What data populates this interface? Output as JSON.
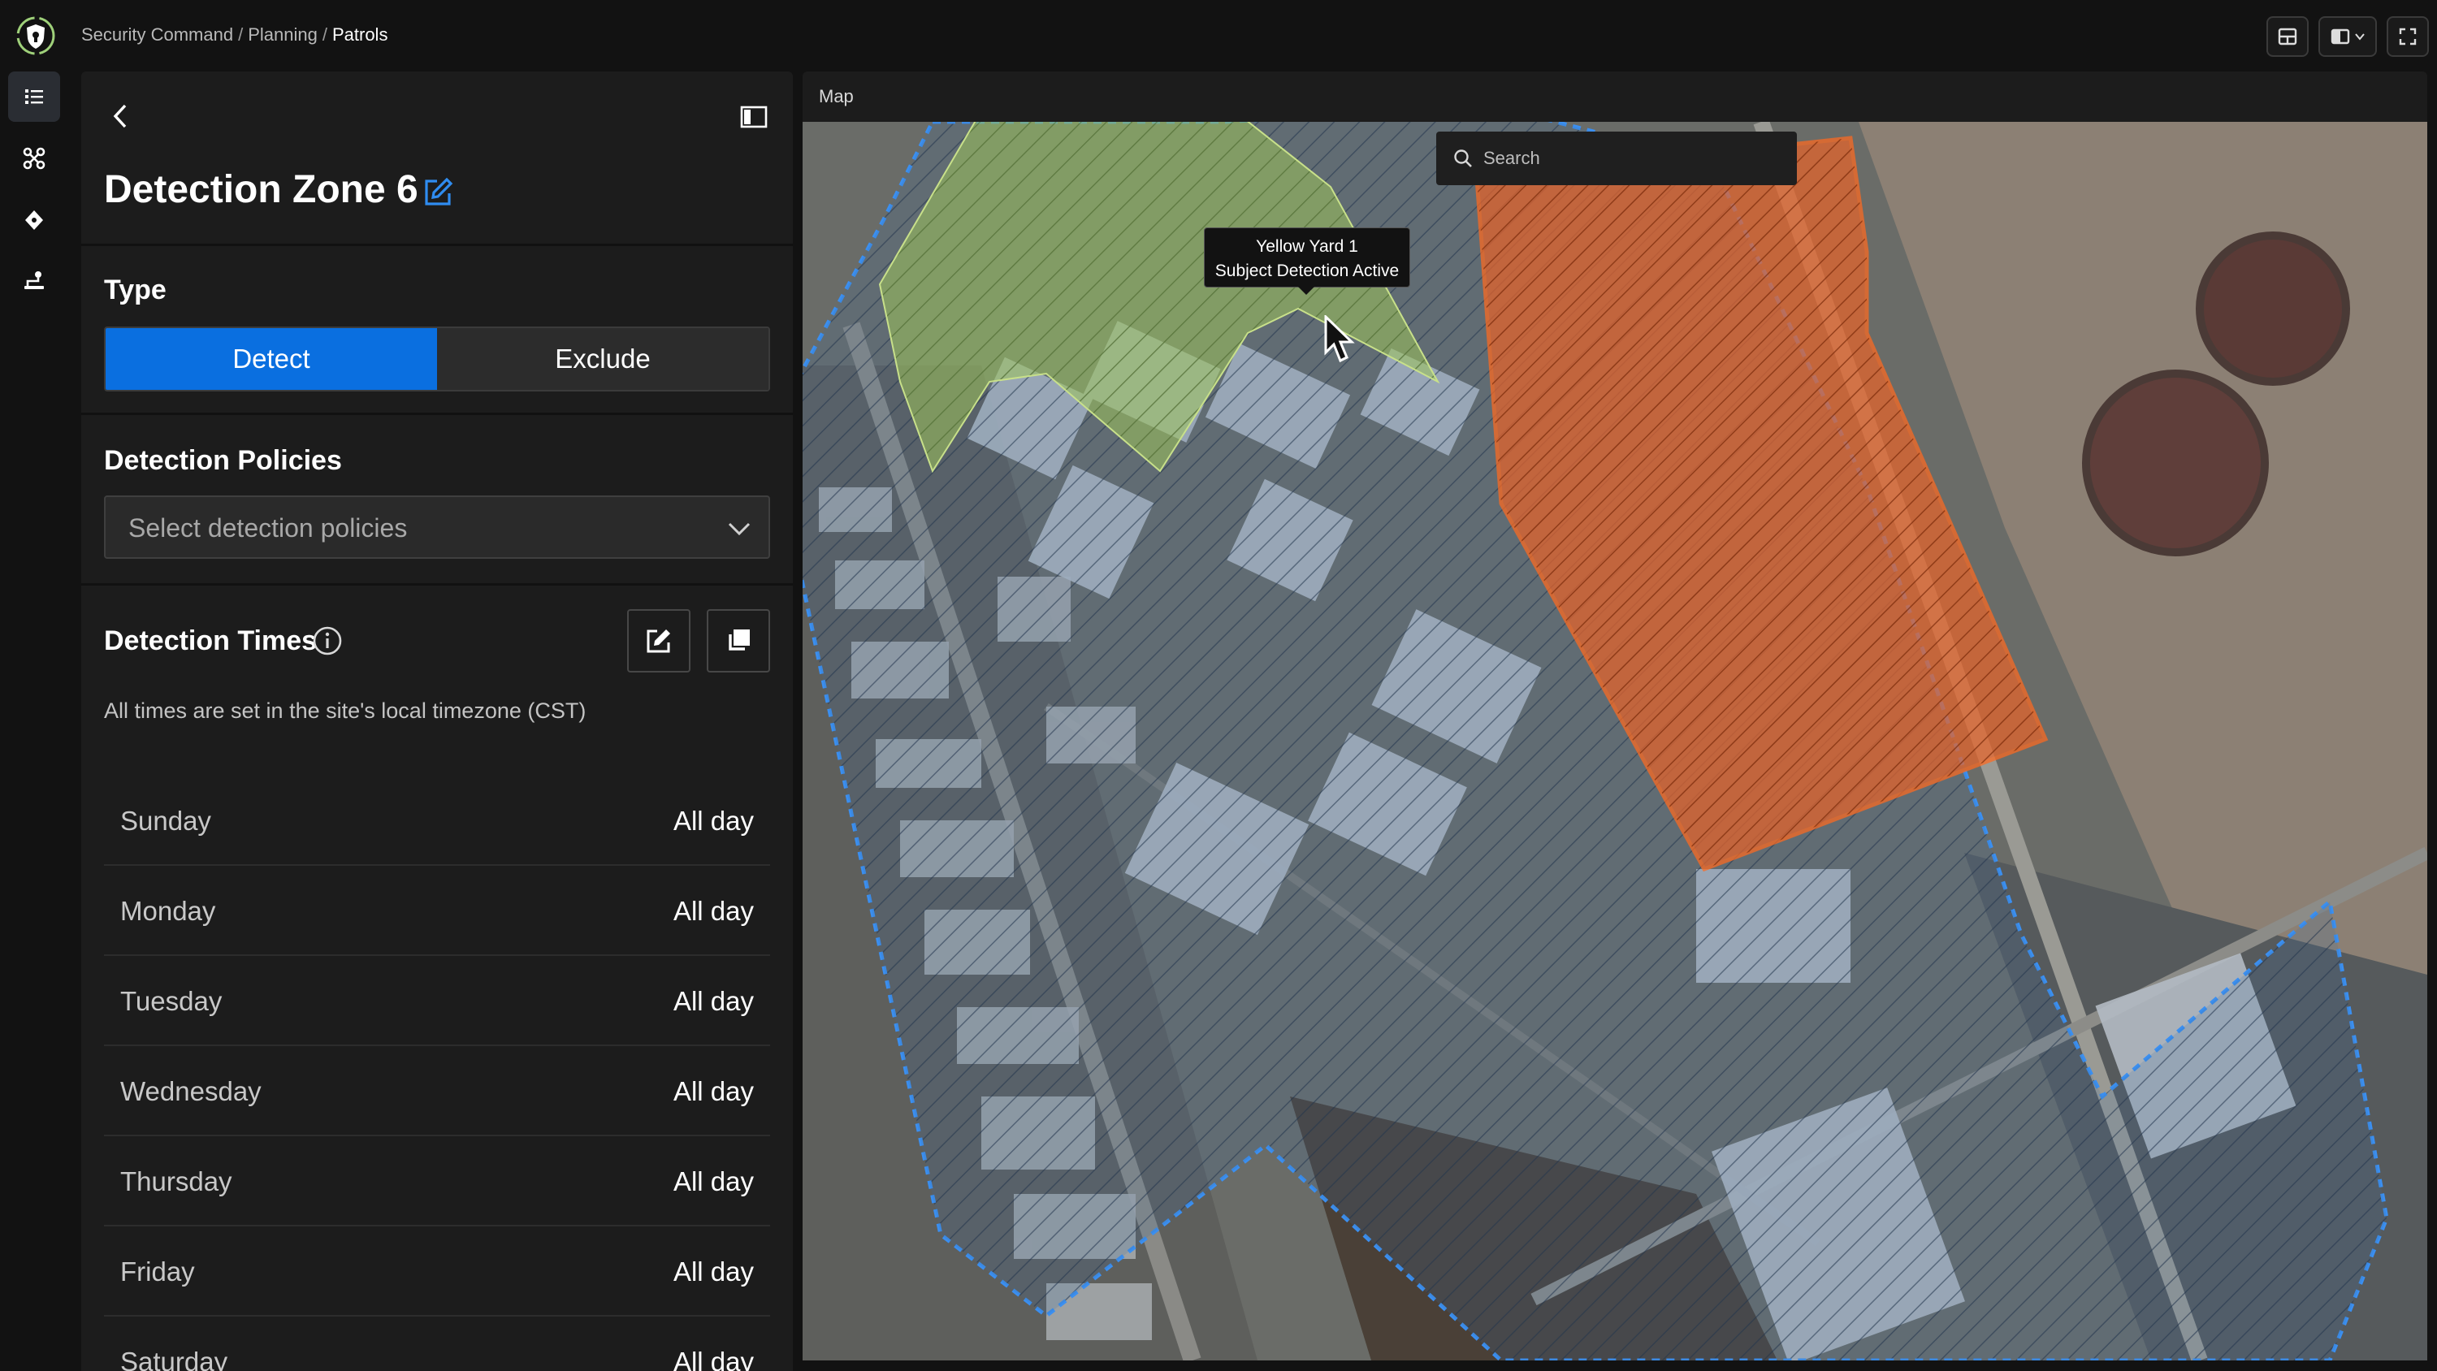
{
  "app": {
    "logo_icon": "shield-logo-icon",
    "breadcrumb": [
      "Security Command",
      "Planning",
      "Patrols"
    ],
    "breadcrumb_separator": "/",
    "toolbar_icons": [
      "layout-icon",
      "split-view-icon",
      "fullscreen-icon"
    ]
  },
  "rail": {
    "items": [
      {
        "icon": "list-icon",
        "active": true
      },
      {
        "icon": "drone-icon",
        "active": false
      },
      {
        "icon": "waypoint-icon",
        "active": false
      },
      {
        "icon": "route-icon",
        "active": false
      }
    ]
  },
  "panel": {
    "title": "Detection Zone 6",
    "type_label": "Type",
    "type_options": {
      "detect": "Detect",
      "exclude": "Exclude"
    },
    "type_selected": "Detect",
    "policies_label": "Detection Policies",
    "policies_placeholder": "Select detection policies",
    "times_label": "Detection Times",
    "timezone_note": "All times are set in the site's local timezone (CST)",
    "days": [
      {
        "day": "Sunday",
        "value": "All day"
      },
      {
        "day": "Monday",
        "value": "All day"
      },
      {
        "day": "Tuesday",
        "value": "All day"
      },
      {
        "day": "Wednesday",
        "value": "All day"
      },
      {
        "day": "Thursday",
        "value": "All day"
      },
      {
        "day": "Friday",
        "value": "All day"
      },
      {
        "day": "Saturday",
        "value": "All day"
      }
    ]
  },
  "map": {
    "label": "Map",
    "search_placeholder": "Search",
    "tooltip": {
      "line1": "Yellow Yard 1",
      "line2": "Subject Detection Active"
    },
    "zone_colors": {
      "detect_zone": "#9fc25a",
      "exclude_zone": "#e8642a",
      "site_boundary": "#3b8ff0"
    }
  },
  "colors": {
    "accent": "#0a6fe0",
    "panel_bg": "#1c1c1c",
    "app_bg": "#121212"
  }
}
